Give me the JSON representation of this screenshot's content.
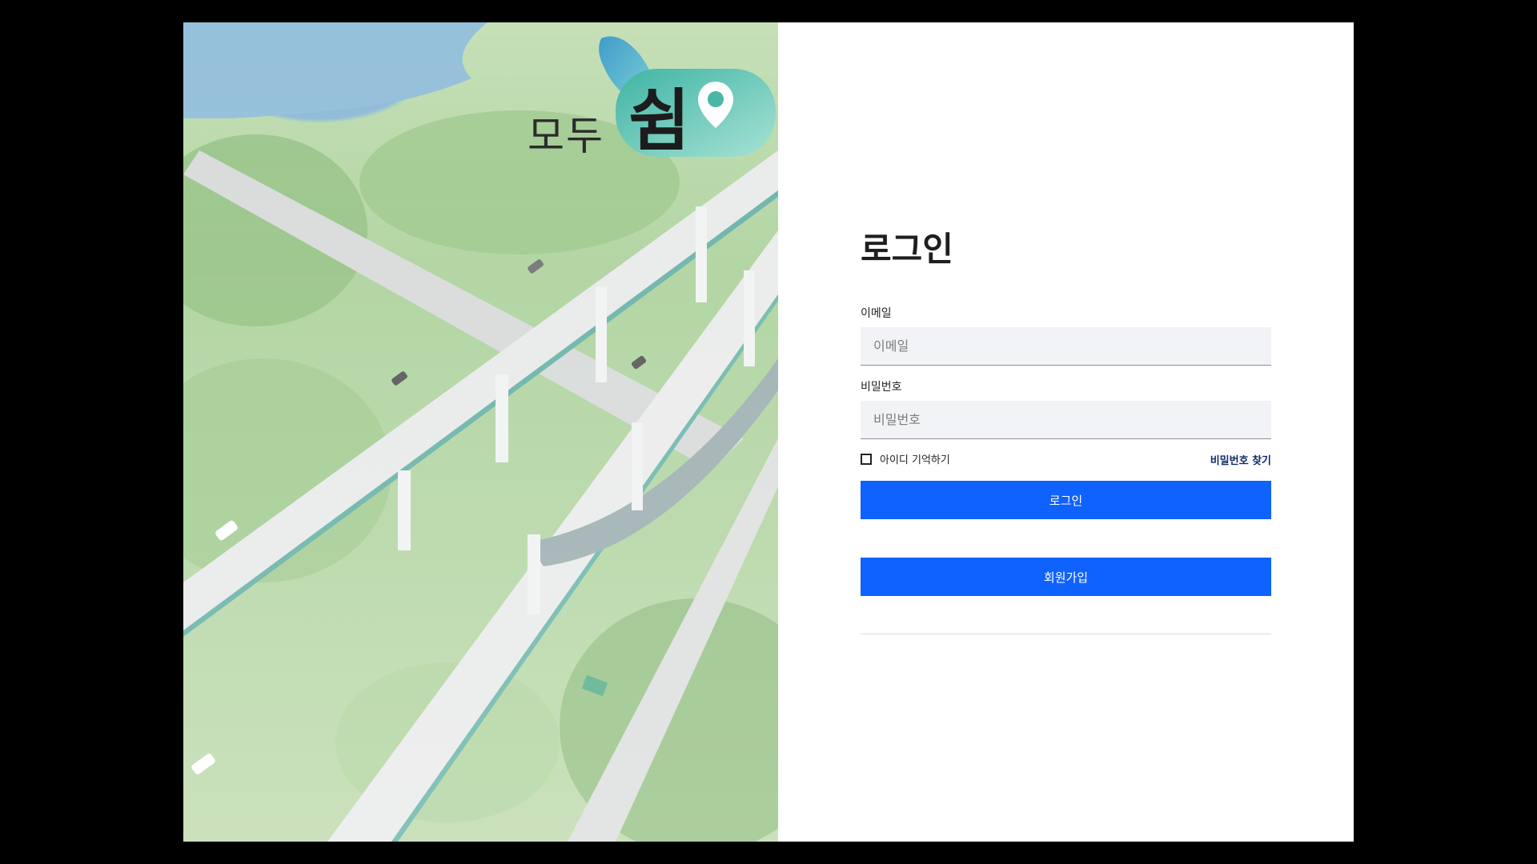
{
  "brand": {
    "prefix": "모두",
    "main": "쉼"
  },
  "login": {
    "title": "로그인",
    "email": {
      "label": "이메일",
      "placeholder": "이메일",
      "value": ""
    },
    "password": {
      "label": "비밀번호",
      "placeholder": "비밀번호",
      "value": ""
    },
    "remember_label": "아이디 기억하기",
    "remember_checked": false,
    "find_password": "비밀번호 찾기",
    "login_button": "로그인",
    "signup_button": "회원가입"
  },
  "colors": {
    "primary": "#0f62fe",
    "link": "#0f2b6b",
    "input_bg": "#f2f3f6",
    "logo_teal": "#5ec8b8"
  },
  "icons": [
    "map-pin-icon",
    "leaf-icon"
  ]
}
